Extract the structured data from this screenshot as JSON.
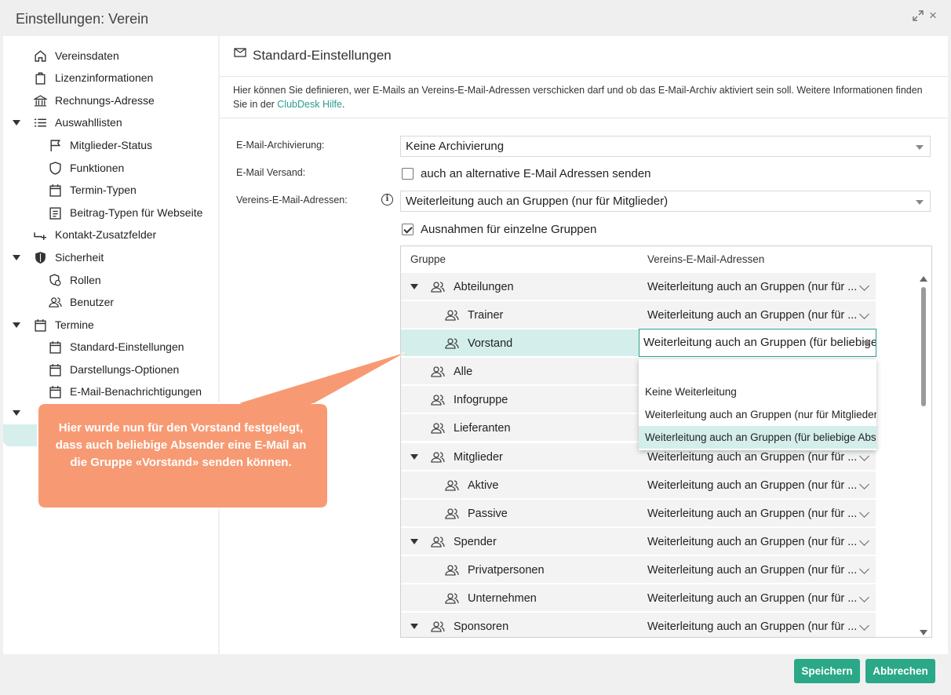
{
  "window": {
    "title": "Einstellungen: Verein",
    "maximize_icon": "expand-icon",
    "close_label": "×"
  },
  "sidebar": {
    "items": [
      {
        "label": "Vereinsdaten",
        "icon": "home-icon"
      },
      {
        "label": "Lizenzinformationen",
        "icon": "bag-icon"
      },
      {
        "label": "Rechnungs-Adresse",
        "icon": "bank-icon"
      },
      {
        "label": "Auswahllisten",
        "icon": "list-icon"
      },
      {
        "label": "Mitglieder-Status",
        "icon": "flag-icon"
      },
      {
        "label": "Funktionen",
        "icon": "shield-outline-icon"
      },
      {
        "label": "Termin-Typen",
        "icon": "calendar-icon"
      },
      {
        "label": "Beitrag-Typen für Webseite",
        "icon": "document-icon"
      },
      {
        "label": "Kontakt-Zusatzfelder",
        "icon": "field-add-icon"
      },
      {
        "label": "Sicherheit",
        "icon": "security-icon"
      },
      {
        "label": "Rollen",
        "icon": "role-icon"
      },
      {
        "label": "Benutzer",
        "icon": "users-icon"
      },
      {
        "label": "Termine",
        "icon": "calendar-icon"
      },
      {
        "label": "Standard-Einstellungen",
        "icon": "calendar-icon"
      },
      {
        "label": "Darstellungs-Optionen",
        "icon": "calendar-icon"
      },
      {
        "label": "E-Mail-Benachrichtigungen",
        "icon": "calendar-icon"
      }
    ]
  },
  "main": {
    "header_title": "Standard-Einstellungen",
    "info_text": "Hier können Sie definieren, wer E-Mails an Vereins-E-Mail-Adressen verschicken darf und ob das E-Mail-Archiv aktiviert sein soll. Weitere Informationen finden Sie in der ",
    "info_link": "ClubDesk Hilfe",
    "info_end": ".",
    "archiving_label": "E-Mail-Archivierung:",
    "archiving_value": "Keine Archivierung",
    "sending_label": "E-Mail Versand:",
    "sending_checkbox_label": "auch an alternative E-Mail Adressen senden",
    "sending_checked": false,
    "club_addresses_label": "Vereins-E-Mail-Adressen:",
    "club_addresses_value": "Weiterleitung auch an Gruppen (nur für Mitglieder)",
    "exceptions_label": "Ausnahmen für einzelne Gruppen",
    "exceptions_checked": true
  },
  "grid": {
    "col_group": "Gruppe",
    "col_addresses": "Vereins-E-Mail-Adressen",
    "rows": [
      {
        "name": "Abteilungen",
        "value": "Weiterleitung auch an Gruppen (nur für ...",
        "level": 0,
        "expandable": true
      },
      {
        "name": "Trainer",
        "value": "Weiterleitung auch an Gruppen (nur für ...",
        "level": 1,
        "expandable": false
      },
      {
        "name": "Vorstand",
        "value": "Weiterleitung auch an Gruppen (für beliebige Absender)",
        "level": 1,
        "expandable": false,
        "selected": true
      },
      {
        "name": "Alle",
        "value": "",
        "level": 0,
        "expandable": false
      },
      {
        "name": "Infogruppe",
        "value": "",
        "level": 0,
        "expandable": false
      },
      {
        "name": "Lieferanten",
        "value": "",
        "level": 0,
        "expandable": false
      },
      {
        "name": "Mitglieder",
        "value": "Weiterleitung auch an Gruppen (nur für ...",
        "level": 0,
        "expandable": true
      },
      {
        "name": "Aktive",
        "value": "Weiterleitung auch an Gruppen (nur für ...",
        "level": 1,
        "expandable": false
      },
      {
        "name": "Passive",
        "value": "Weiterleitung auch an Gruppen (nur für ...",
        "level": 1,
        "expandable": false
      },
      {
        "name": "Spender",
        "value": "Weiterleitung auch an Gruppen (nur für ...",
        "level": 0,
        "expandable": true
      },
      {
        "name": "Privatpersonen",
        "value": "Weiterleitung auch an Gruppen (nur für ...",
        "level": 1,
        "expandable": false
      },
      {
        "name": "Unternehmen",
        "value": "Weiterleitung auch an Gruppen (nur für ...",
        "level": 1,
        "expandable": false
      },
      {
        "name": "Sponsoren",
        "value": "Weiterleitung auch an Gruppen (nur für ...",
        "level": 0,
        "expandable": true
      }
    ],
    "editor_value": "Weiterleitung auch an Gruppen (für beliebige Absender)",
    "dropdown_options": [
      "",
      "Keine Weiterleitung",
      "Weiterleitung auch an Gruppen (nur für Mitglieder)",
      "Weiterleitung auch an Gruppen (für beliebige Absender)"
    ],
    "dropdown_highlighted": 3
  },
  "callout": {
    "text": "Hier wurde nun für den Vorstand festgelegt, dass auch beliebige Absender eine E-Mail an die Gruppe «Vorstand» senden können.",
    "color": "#f79a73"
  },
  "buttons": {
    "save": "Speichern",
    "cancel": "Abbrechen",
    "color": "#2aa887"
  },
  "colors": {
    "accent": "#2a9d8f",
    "selection": "#d4efeb"
  }
}
